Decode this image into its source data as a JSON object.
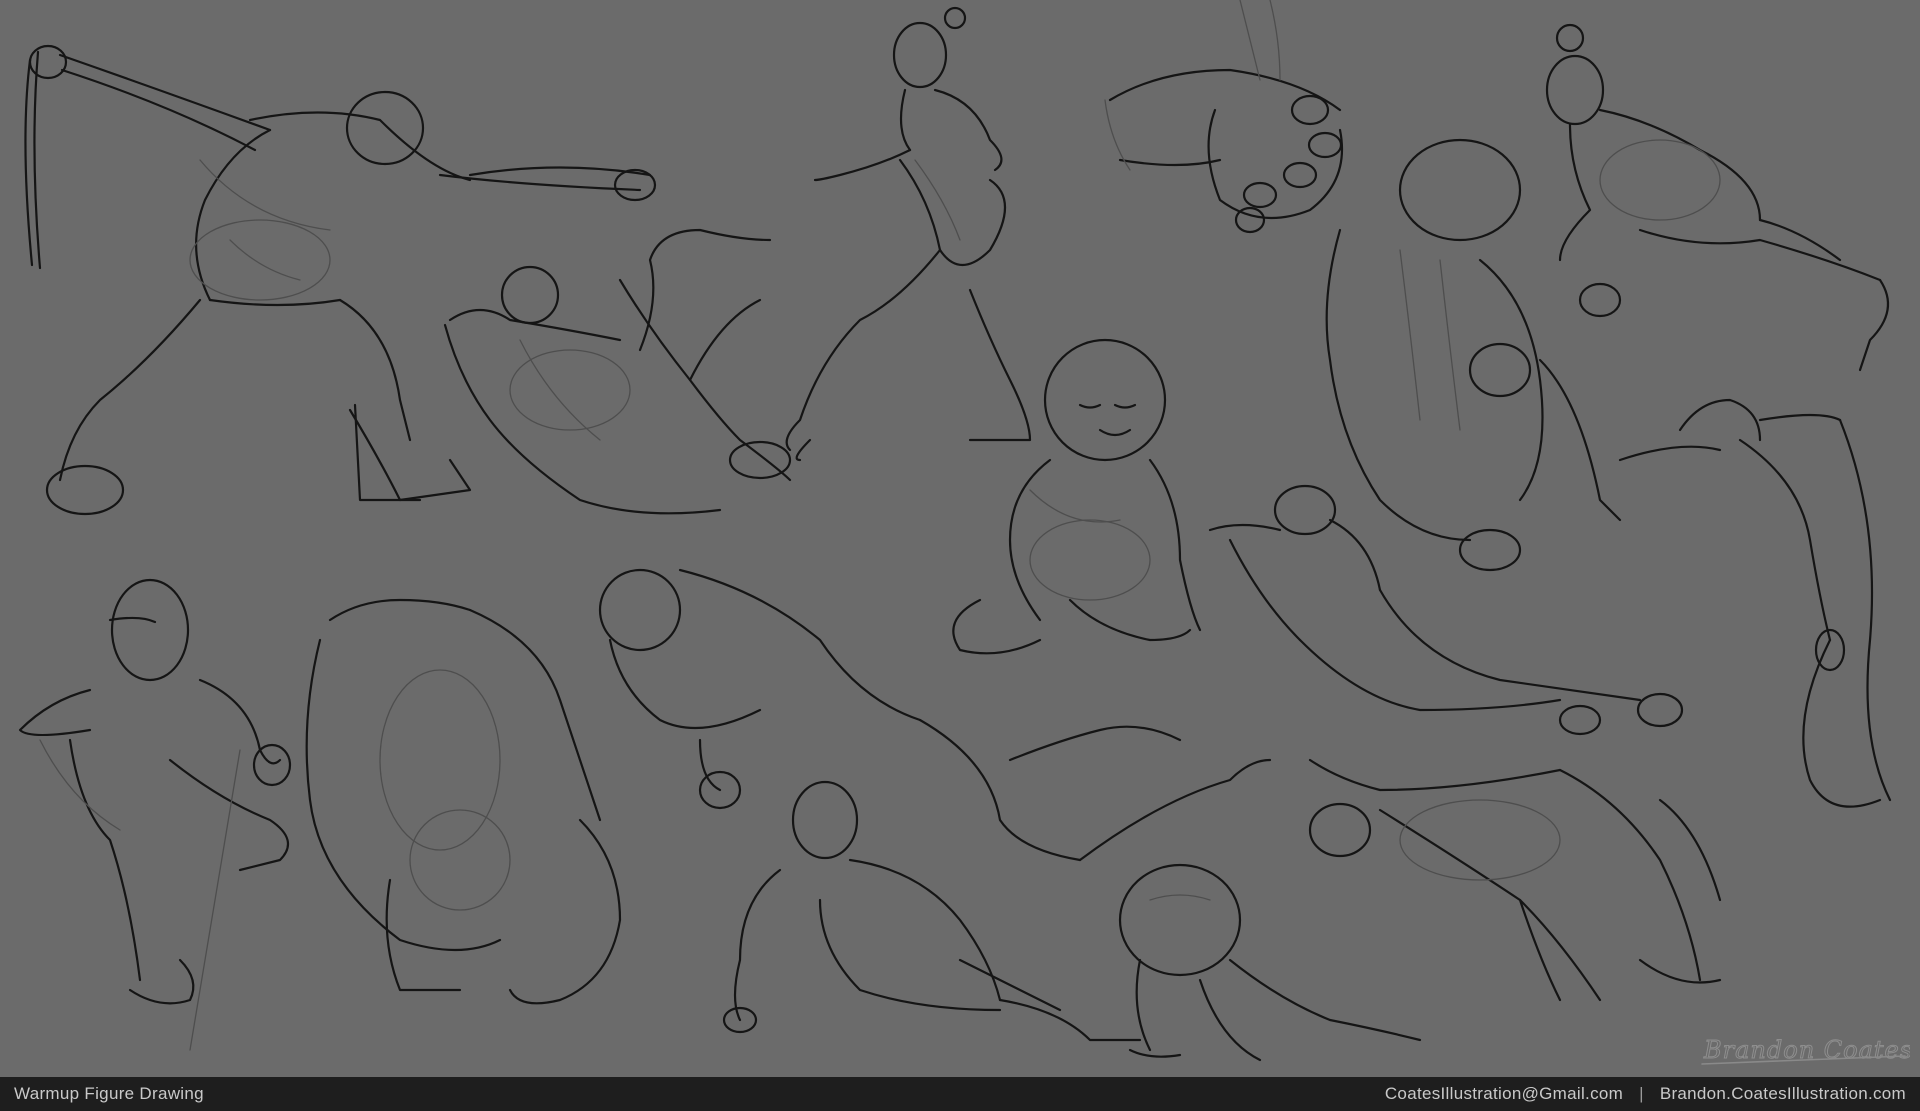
{
  "footer": {
    "title": "Warmup Figure Drawing",
    "email": "CoatesIllustration@Gmail.com",
    "separator": "|",
    "website": "Brandon.CoatesIllustration.com"
  },
  "signature": {
    "text": "Brandon Coates"
  },
  "colors": {
    "canvas": "#6b6b6b",
    "ink": "#151515",
    "footer_bg": "#1e1e1e",
    "footer_text": "#c9c9c9"
  }
}
